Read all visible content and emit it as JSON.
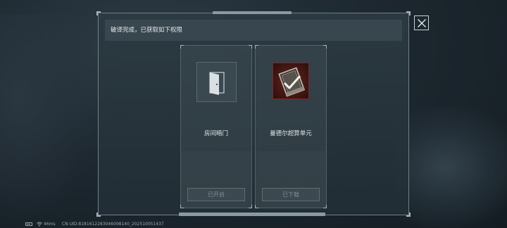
{
  "dialog": {
    "header": "破译完成，已获取如下权限"
  },
  "cards": [
    {
      "icon": "door-icon",
      "label": "房间暗门",
      "button_label": "已开启"
    },
    {
      "icon": "data-module-icon",
      "label": "曼德尔超算单元",
      "button_label": "已下载"
    }
  ],
  "status_bar": {
    "ping": "46ms",
    "uid": "CN UID:8181612283046098140_202510051437"
  },
  "colors": {
    "panel_border": "#6f8088",
    "icon_red": "#6b2320",
    "text": "#e4eaec",
    "disabled_text": "#7e8c92"
  }
}
